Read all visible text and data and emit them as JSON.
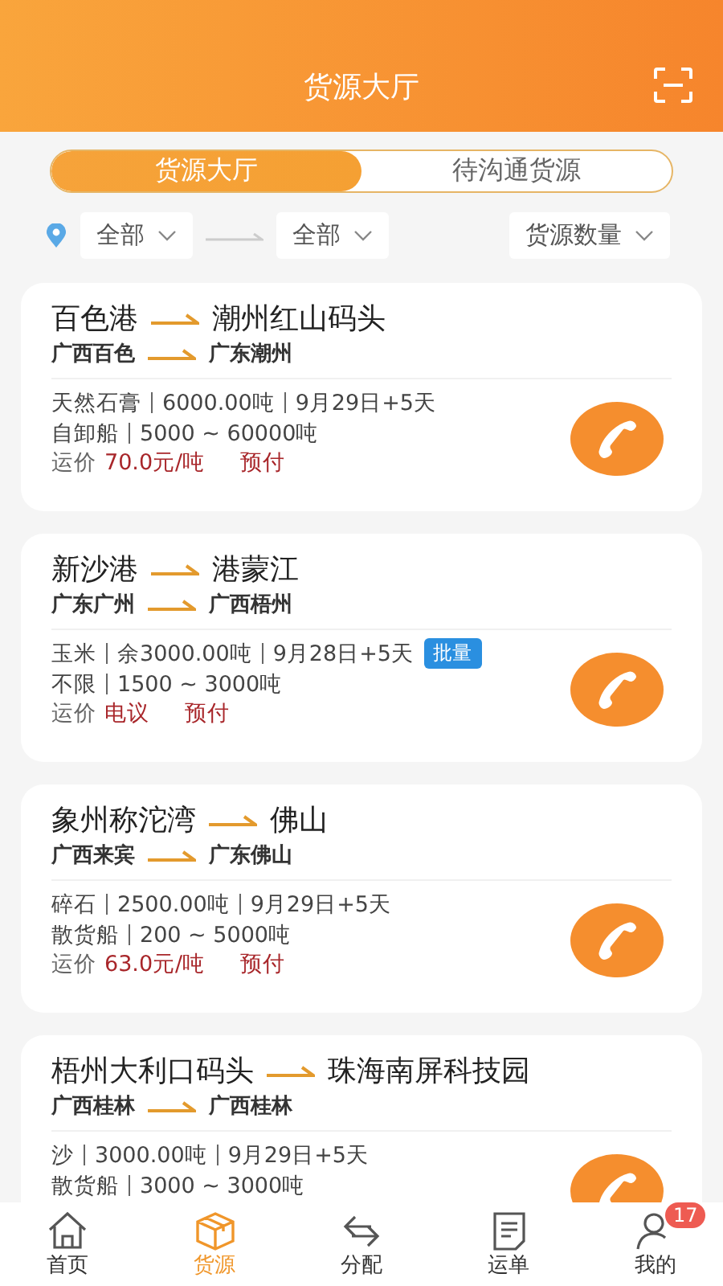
{
  "header": {
    "title": "货源大厅"
  },
  "segments": [
    {
      "label": "货源大厅",
      "selected": true
    },
    {
      "label": "待沟通货源",
      "selected": false
    }
  ],
  "filters": {
    "origin": "全部",
    "destination": "全部",
    "sort": "货源数量"
  },
  "cards": [
    {
      "from_port": "百色港",
      "to_port": "潮州红山码头",
      "from_region": "广西百色",
      "to_region": "广东潮州",
      "cargo": "天然石膏",
      "quantity": "6000.00吨",
      "date": "9月29日+5天",
      "ship": "自卸船",
      "tonnage": "5000 ~ 60000吨",
      "price_label": "运价",
      "price": "70.0元/吨",
      "payment": "预付"
    },
    {
      "from_port": "新沙港",
      "to_port": "港蒙江",
      "from_region": "广东广州",
      "to_region": "广西梧州",
      "cargo": "玉米",
      "quantity": "余3000.00吨",
      "date": "9月28日+5天",
      "badge": "批量",
      "ship": "不限",
      "tonnage": "1500 ~ 3000吨",
      "price_label": "运价",
      "price": "电议",
      "payment": "预付"
    },
    {
      "from_port": "象州称沱湾",
      "to_port": "佛山",
      "from_region": "广西来宾",
      "to_region": "广东佛山",
      "cargo": "碎石",
      "quantity": "2500.00吨",
      "date": "9月29日+5天",
      "ship": "散货船",
      "tonnage": "200 ~ 5000吨",
      "price_label": "运价",
      "price": "63.0元/吨",
      "payment": "预付"
    },
    {
      "from_port": "梧州大利口码头",
      "to_port": "珠海南屏科技园",
      "from_region": "广西桂林",
      "to_region": "广西桂林",
      "cargo": "沙",
      "quantity": "3000.00吨",
      "date": "9月29日+5天",
      "ship": "散货船",
      "tonnage": "3000 ~ 3000吨"
    }
  ],
  "tabs": [
    {
      "label": "首页",
      "selected": false
    },
    {
      "label": "货源",
      "selected": true
    },
    {
      "label": "分配",
      "selected": false
    },
    {
      "label": "运单",
      "selected": false
    },
    {
      "label": "我的",
      "selected": false,
      "badge": "17"
    }
  ]
}
